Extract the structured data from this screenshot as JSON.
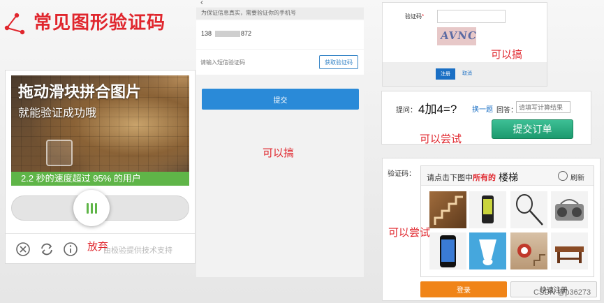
{
  "heading": {
    "title": "常见图形验证码"
  },
  "slider_captcha": {
    "image_headline": "拖动滑块拼合图片",
    "image_subhead": "就能验证成功哦",
    "image_stats": "2.2 秒的速度超过 95% 的用户",
    "give_up_label": "放弃",
    "provider_credit": "由极验提供技术支持"
  },
  "sms_form": {
    "notice": "为保证信息真实，需要验证你的手机号",
    "phone_prefix": "138",
    "phone_suffix": "872",
    "code_placeholder": "请输入短信验证码",
    "get_code_button": "获取验证码",
    "submit_button": "提交",
    "note": "可以搞"
  },
  "text_captcha": {
    "label": "验证码",
    "required_mark": "*",
    "image_text": "AVNC",
    "register_button": "注册",
    "cancel_link": "取消",
    "note": "可以搞"
  },
  "math_captcha": {
    "question_label": "提问：",
    "question": "4加4=?",
    "refresh_link": "换一题",
    "answer_label": "回答：",
    "answer_placeholder": "请填写计算结果",
    "submit_button": "提交订单",
    "note": "可以尝试"
  },
  "image_captcha": {
    "label": "验证码：",
    "prompt_prefix": "请点击下图中",
    "prompt_emphasis": "所有的",
    "keyword": "楼梯",
    "refresh_label": "刷新",
    "tiles": [
      "stairs-tile",
      "phone-tile",
      "racket-tile",
      "radio-tile",
      "smartphone-tile",
      "shuttlecock-tile",
      "stairwell-tile",
      "bench-tile"
    ],
    "login_button": "登录",
    "register_button": "快速注册",
    "note": "可以尝试"
  },
  "colors": {
    "accent_red": "#e0262d",
    "slider_green": "#5fb548",
    "primary_blue": "#2a8ad8",
    "math_green": "#1c9a6e",
    "login_orange": "#f08418"
  },
  "watermark": "CSDN @p36273"
}
